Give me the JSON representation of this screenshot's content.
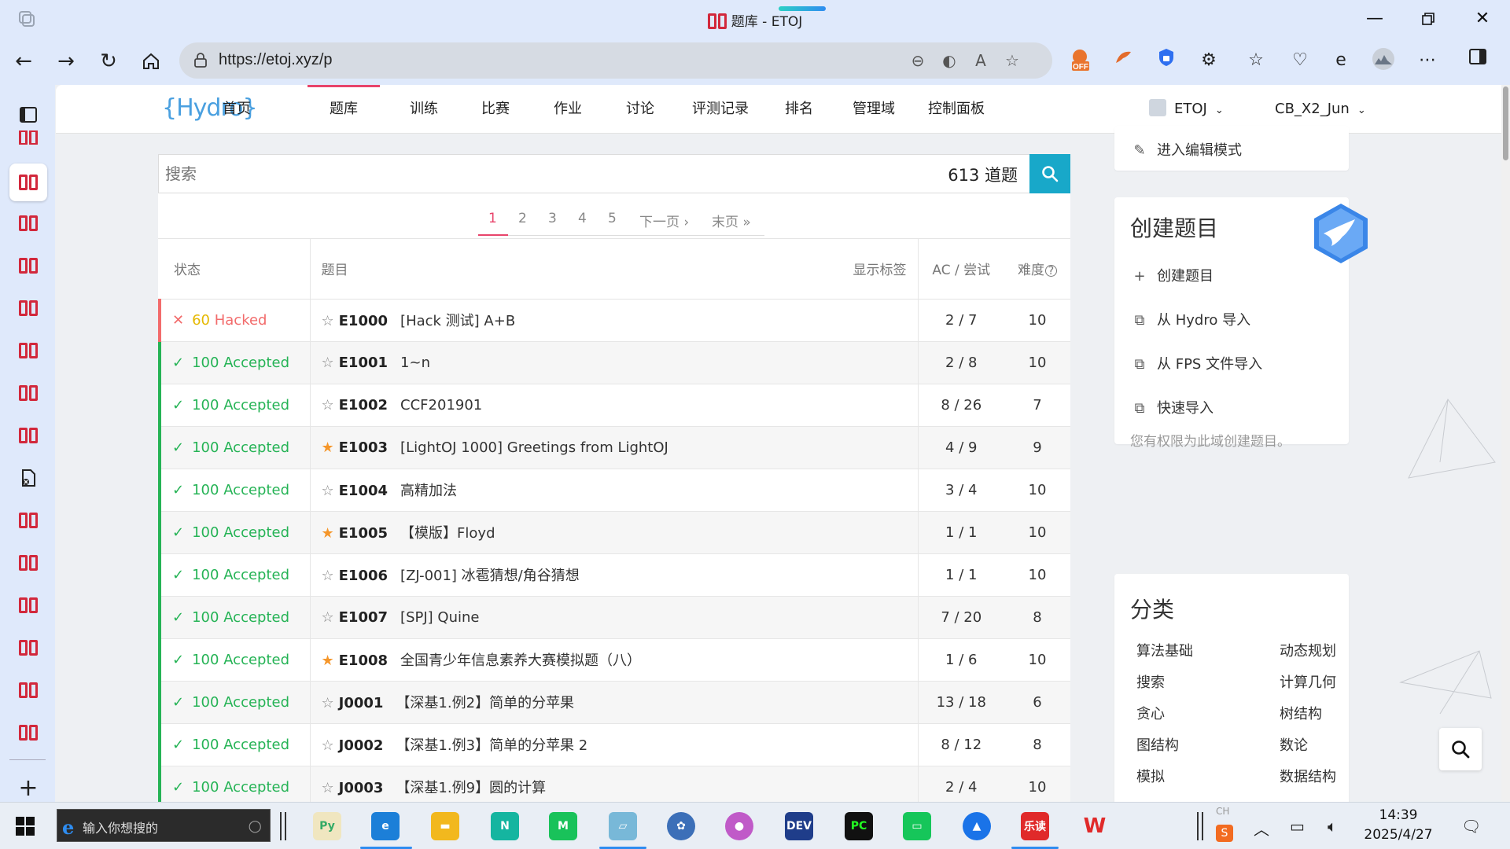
{
  "browser": {
    "tab_title": "题库 - ETOJ",
    "url": "https://etoj.xyz/p"
  },
  "nav": {
    "logo": "{Hydro}",
    "items": [
      "首页",
      "题库",
      "训练",
      "比赛",
      "作业",
      "讨论",
      "评测记录",
      "排名",
      "管理域",
      "控制面板"
    ],
    "active": "题库",
    "domain": "ETOJ",
    "user": "CB_X2_Jun"
  },
  "search": {
    "placeholder": "搜索",
    "count_label": "613 道题"
  },
  "pager": {
    "pages": [
      "1",
      "2",
      "3",
      "4",
      "5"
    ],
    "current": "1",
    "next": "下一页 ›",
    "last": "末页 »"
  },
  "table": {
    "headers": {
      "status": "状态",
      "title": "题目",
      "show_tags": "显示标签",
      "ac": "AC / 尝试",
      "difficulty": "难度"
    },
    "rows": [
      {
        "status": "hacked",
        "score": "60",
        "label": "Hacked",
        "starred": false,
        "pid": "E1000",
        "title": "[Hack 测试] A+B",
        "ac": "2 / 7",
        "difficulty": "10"
      },
      {
        "status": "ok",
        "score": "100",
        "label": "Accepted",
        "starred": false,
        "pid": "E1001",
        "title": "1~n",
        "ac": "2 / 8",
        "difficulty": "10"
      },
      {
        "status": "ok",
        "score": "100",
        "label": "Accepted",
        "starred": false,
        "pid": "E1002",
        "title": "CCF201901",
        "ac": "8 / 26",
        "difficulty": "7"
      },
      {
        "status": "ok",
        "score": "100",
        "label": "Accepted",
        "starred": true,
        "pid": "E1003",
        "title": "[LightOJ 1000] Greetings from LightOJ",
        "ac": "4 / 9",
        "difficulty": "9"
      },
      {
        "status": "ok",
        "score": "100",
        "label": "Accepted",
        "starred": false,
        "pid": "E1004",
        "title": "高精加法",
        "ac": "3 / 4",
        "difficulty": "10"
      },
      {
        "status": "ok",
        "score": "100",
        "label": "Accepted",
        "starred": true,
        "pid": "E1005",
        "title": "【模版】Floyd",
        "ac": "1 / 1",
        "difficulty": "10"
      },
      {
        "status": "ok",
        "score": "100",
        "label": "Accepted",
        "starred": false,
        "pid": "E1006",
        "title": "[ZJ-001] 冰雹猜想/角谷猜想",
        "ac": "1 / 1",
        "difficulty": "10"
      },
      {
        "status": "ok",
        "score": "100",
        "label": "Accepted",
        "starred": false,
        "pid": "E1007",
        "title": "[SPJ] Quine",
        "ac": "7 / 20",
        "difficulty": "8"
      },
      {
        "status": "ok",
        "score": "100",
        "label": "Accepted",
        "starred": true,
        "pid": "E1008",
        "title": "全国青少年信息素养大赛模拟题（八）",
        "ac": "1 / 6",
        "difficulty": "10"
      },
      {
        "status": "ok",
        "score": "100",
        "label": "Accepted",
        "starred": false,
        "pid": "J0001",
        "title": "【深基1.例2】简单的分苹果",
        "ac": "13 / 18",
        "difficulty": "6"
      },
      {
        "status": "ok",
        "score": "100",
        "label": "Accepted",
        "starred": false,
        "pid": "J0002",
        "title": "【深基1.例3】简单的分苹果 2",
        "ac": "8 / 12",
        "difficulty": "8"
      },
      {
        "status": "ok",
        "score": "100",
        "label": "Accepted",
        "starred": false,
        "pid": "J0003",
        "title": "【深基1.例9】圆的计算",
        "ac": "2 / 4",
        "difficulty": "10"
      }
    ]
  },
  "sidebar": {
    "edit_mode": "进入编辑模式",
    "create": {
      "heading": "创建题目",
      "links": [
        "创建题目",
        "从 Hydro 导入",
        "从 FPS 文件导入",
        "快速导入"
      ],
      "note": "您有权限为此域创建题目。"
    },
    "categories": {
      "heading": "分类",
      "items": [
        "算法基础",
        "动态规划",
        "搜索",
        "计算几何",
        "贪心",
        "树结构",
        "图结构",
        "数论",
        "模拟",
        "数据结构"
      ]
    }
  },
  "taskbar": {
    "search_placeholder": "输入你想搜的",
    "time": "14:39",
    "date": "2025/4/27",
    "ime": "CH"
  },
  "colors": {
    "accent": "#e8446b",
    "accepted": "#25b355",
    "hacked": "#f26b6b",
    "search_button": "#18a8c9",
    "star_on": "#f5962a"
  }
}
